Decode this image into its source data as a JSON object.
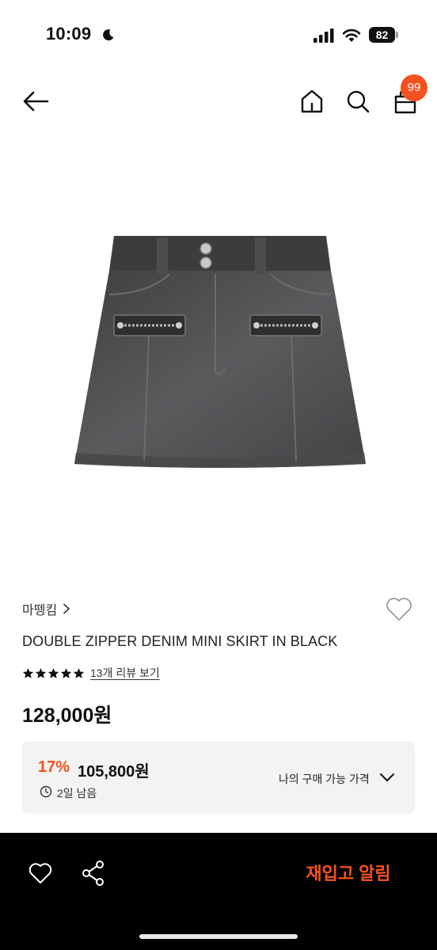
{
  "status_bar": {
    "time": "10:09",
    "battery": "82",
    "icons": [
      "moon-icon",
      "signal-icon",
      "wifi-icon",
      "battery-icon"
    ]
  },
  "nav": {
    "icons": [
      "back-arrow-icon",
      "home-icon",
      "search-icon",
      "shopping-bag-icon"
    ],
    "cart_badge": "99"
  },
  "product": {
    "brand": "마뗑킴",
    "title": "DOUBLE ZIPPER DENIM MINI SKIRT IN BLACK",
    "rating_stars": 5,
    "review_link": "13개 리뷰 보기",
    "price": "128,000원",
    "image": "black-denim-mini-skirt"
  },
  "discount": {
    "rate": "17%",
    "price": "105,800원",
    "time_left": "2일 남음",
    "my_price_label": "나의 구매 가능 가격"
  },
  "bottom_bar": {
    "restock_label": "재입고 알림",
    "icons": [
      "heart-icon",
      "share-icon"
    ]
  },
  "colors": {
    "accent": "#f4511e",
    "badge": "#f4511e",
    "bottom_bar_bg": "#000000",
    "discount_box_bg": "#f3f3f3"
  }
}
